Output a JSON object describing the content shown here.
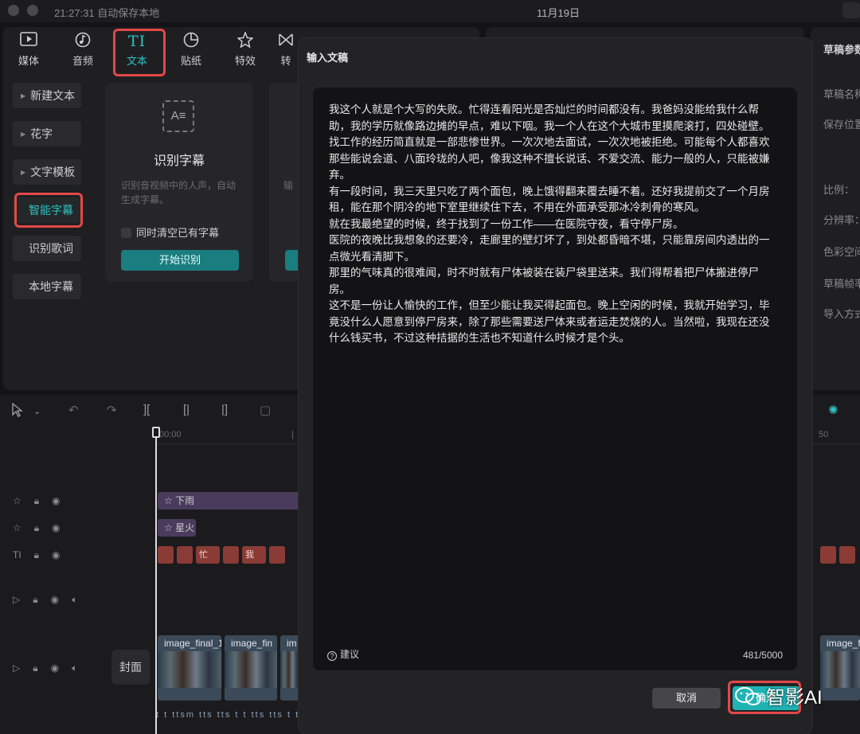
{
  "titlebar": {
    "autosave": "21:27:31 自动保存本地",
    "date": "11月19日"
  },
  "toolbar": {
    "tabs": [
      {
        "label": "媒体",
        "icon": "media-icon"
      },
      {
        "label": "音频",
        "icon": "audio-icon"
      },
      {
        "label": "文本",
        "icon": "text-icon",
        "active": true
      },
      {
        "label": "贴纸",
        "icon": "sticker-icon"
      },
      {
        "label": "特效",
        "icon": "effects-icon"
      },
      {
        "label": "转",
        "icon": "transition-icon"
      }
    ]
  },
  "sidebar": {
    "items": [
      {
        "label": "新建文本"
      },
      {
        "label": "花字"
      },
      {
        "label": "文字模板"
      },
      {
        "label": "智能字幕",
        "active": true
      },
      {
        "label": "识别歌词"
      },
      {
        "label": "本地字幕"
      }
    ]
  },
  "card": {
    "icon_text": "A≡",
    "title": "识别字幕",
    "desc": "识别音视频中的人声，自动生成字幕。",
    "checkbox_label": "同时清空已有字幕",
    "button": "开始识别",
    "card2_desc": "输"
  },
  "right_panel": {
    "title": "草稿参数",
    "labels": [
      "草稿名称",
      "保存位置",
      "比例：",
      "分辨率：",
      "色彩空间",
      "草稿帧率",
      "导入方式"
    ]
  },
  "timeline": {
    "ruler_labels": [
      "00:00",
      "|",
      "50"
    ],
    "cover_label": "封面",
    "fx_clips": [
      {
        "label": "下雨"
      },
      {
        "label": "星火"
      }
    ],
    "text_clip_chars": [
      "忙",
      "我"
    ],
    "video_clips": [
      "image_final_1",
      "image_fin",
      "im",
      "image_f"
    ],
    "tts_row": "t t ttsm tts tts t t tts tts t tts tts"
  },
  "modal": {
    "title": "输入文稿",
    "paragraphs": [
      "我这个人就是个大写的失败。忙得连看阳光是否灿烂的时间都没有。我爸妈没能给我什么帮助，我的学历就像路边摊的早点，难以下咽。我一个人在这个大城市里摸爬滚打，四处碰壁。",
      "找工作的经历简直就是一部悲惨世界。一次次地去面试，一次次地被拒绝。可能每个人都喜欢那些能说会道、八面玲珑的人吧，像我这种不擅长说话、不爱交流、能力一般的人，只能被嫌弃。",
      "有一段时间，我三天里只吃了两个面包，晚上饿得翻来覆去睡不着。还好我提前交了一个月房租，能在那个阴冷的地下室里继续住下去，不用在外面承受那冰冷刺骨的寒风。",
      "就在我最绝望的时候，终于找到了一份工作——在医院守夜，看守停尸房。",
      "医院的夜晚比我想象的还要冷，走廊里的壁灯坏了，到处都昏暗不堪，只能靠房间内透出的一点微光看清脚下。",
      "那里的气味真的很难闻，时不时就有尸体被装在装尸袋里送来。我们得帮着把尸体搬进停尸房。",
      "这不是一份让人愉快的工作，但至少能让我买得起面包。晚上空闲的时候，我就开始学习，毕竟没什么人愿意到停尸房来，除了那些需要送尸体来或者运走焚烧的人。当然啦，我现在还没什么钱买书，不过这种拮据的生活也不知道什么时候才是个头。"
    ],
    "suggest_label": "建议",
    "counter": "481/5000",
    "cancel_label": "取消",
    "confirm_label": "确定"
  },
  "watermark": {
    "text": "智影AI"
  },
  "colors": {
    "accent": "#2ec2c2",
    "highlight_box": "#e34848"
  }
}
